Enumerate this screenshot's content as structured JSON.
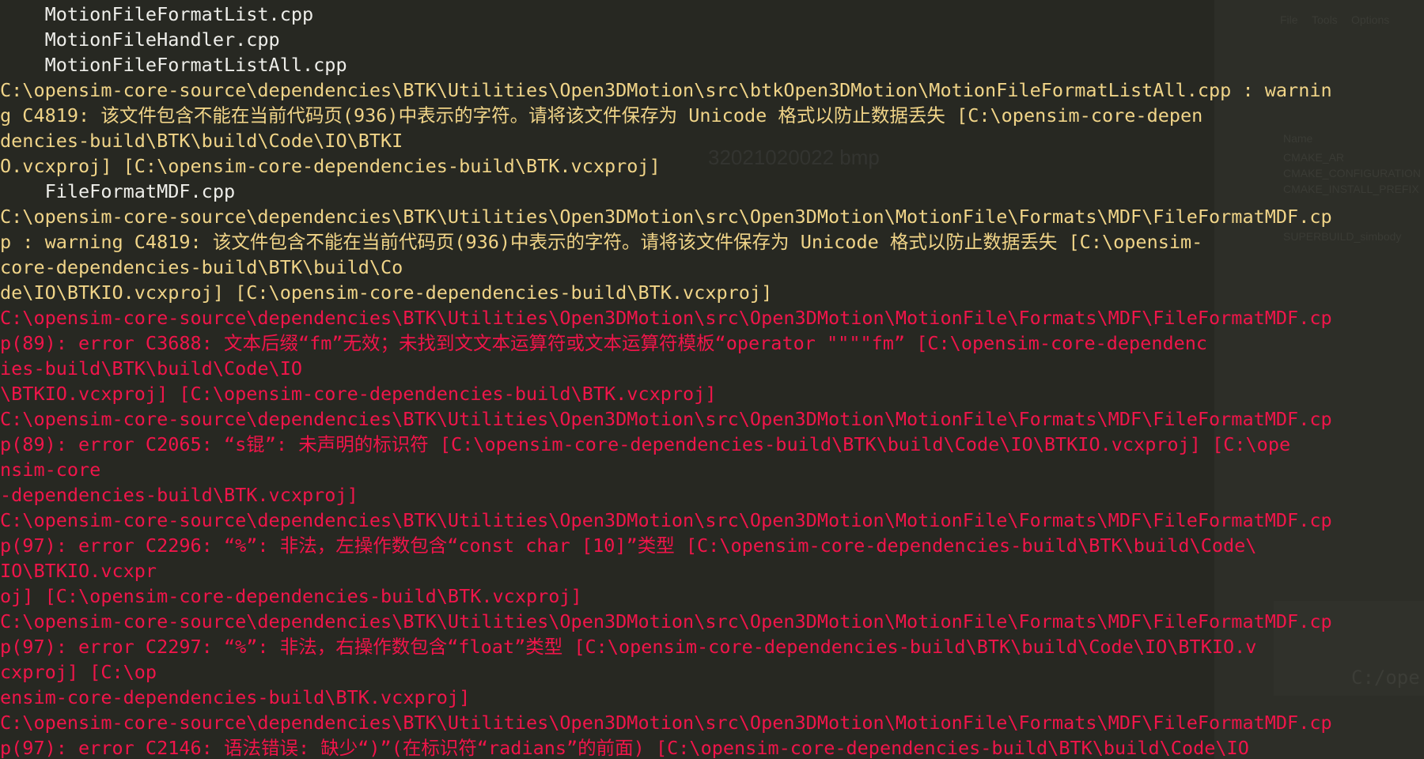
{
  "background_window": {
    "menu_items": [
      "File",
      "Tools",
      "Options"
    ],
    "labels": [
      "Name",
      "CMAKE_AR",
      "CMAKE_CONFIGURATION",
      "CMAKE_INSTALL_PREFIX",
      "SUPERBUILD_simbody"
    ],
    "path_fragment": "C:/ope",
    "file_fragment": "32021020022 bmp"
  },
  "colors": {
    "background": "#272822",
    "normal": "#eeeeea",
    "warning": "#f0d488",
    "error": "#f0154a"
  },
  "console": {
    "lines": [
      {
        "type": "normal",
        "text": "    MotionFileFormatList.cpp"
      },
      {
        "type": "normal",
        "text": "    MotionFileHandler.cpp"
      },
      {
        "type": "normal",
        "text": "    MotionFileFormatListAll.cpp"
      },
      {
        "type": "warning",
        "text": "C:\\opensim-core-source\\dependencies\\BTK\\Utilities\\Open3DMotion\\src\\btkOpen3DMotion\\MotionFileFormatListAll.cpp : warnin"
      },
      {
        "type": "warning",
        "text": "g C4819: 该文件包含不能在当前代码页(936)中表示的字符。请将该文件保存为 Unicode 格式以防止数据丢失 [C:\\opensim-core-depen"
      },
      {
        "type": "warning",
        "text": "dencies-build\\BTK\\build\\Code\\IO\\BTKI"
      },
      {
        "type": "warning",
        "text": "O.vcxproj] [C:\\opensim-core-dependencies-build\\BTK.vcxproj]"
      },
      {
        "type": "normal",
        "text": "    FileFormatMDF.cpp"
      },
      {
        "type": "warning",
        "text": "C:\\opensim-core-source\\dependencies\\BTK\\Utilities\\Open3DMotion\\src\\Open3DMotion\\MotionFile\\Formats\\MDF\\FileFormatMDF.cp"
      },
      {
        "type": "warning",
        "text": "p : warning C4819: 该文件包含不能在当前代码页(936)中表示的字符。请将该文件保存为 Unicode 格式以防止数据丢失 [C:\\opensim-"
      },
      {
        "type": "warning",
        "text": "core-dependencies-build\\BTK\\build\\Co"
      },
      {
        "type": "warning",
        "text": "de\\IO\\BTKIO.vcxproj] [C:\\opensim-core-dependencies-build\\BTK.vcxproj]"
      },
      {
        "type": "error",
        "text": "C:\\opensim-core-source\\dependencies\\BTK\\Utilities\\Open3DMotion\\src\\Open3DMotion\\MotionFile\\Formats\\MDF\\FileFormatMDF.cp"
      },
      {
        "type": "error",
        "text": "p(89): error C3688: 文本后缀“fm”无效；未找到文文本运算符或文本运算符模板“operator \"\"\"\"fm” [C:\\opensim-core-dependenc"
      },
      {
        "type": "error",
        "text": "ies-build\\BTK\\build\\Code\\IO"
      },
      {
        "type": "error",
        "text": "\\BTKIO.vcxproj] [C:\\opensim-core-dependencies-build\\BTK.vcxproj]"
      },
      {
        "type": "error",
        "text": "C:\\opensim-core-source\\dependencies\\BTK\\Utilities\\Open3DMotion\\src\\Open3DMotion\\MotionFile\\Formats\\MDF\\FileFormatMDF.cp"
      },
      {
        "type": "error",
        "text": "p(89): error C2065: “s锟”: 未声明的标识符 [C:\\opensim-core-dependencies-build\\BTK\\build\\Code\\IO\\BTKIO.vcxproj] [C:\\ope"
      },
      {
        "type": "error",
        "text": "nsim-core"
      },
      {
        "type": "error",
        "text": "-dependencies-build\\BTK.vcxproj]"
      },
      {
        "type": "error",
        "text": "C:\\opensim-core-source\\dependencies\\BTK\\Utilities\\Open3DMotion\\src\\Open3DMotion\\MotionFile\\Formats\\MDF\\FileFormatMDF.cp"
      },
      {
        "type": "error",
        "text": "p(97): error C2296: “%”: 非法，左操作数包含“const char [10]”类型 [C:\\opensim-core-dependencies-build\\BTK\\build\\Code\\"
      },
      {
        "type": "error",
        "text": "IO\\BTKIO.vcxpr"
      },
      {
        "type": "error",
        "text": "oj] [C:\\opensim-core-dependencies-build\\BTK.vcxproj]"
      },
      {
        "type": "error",
        "text": "C:\\opensim-core-source\\dependencies\\BTK\\Utilities\\Open3DMotion\\src\\Open3DMotion\\MotionFile\\Formats\\MDF\\FileFormatMDF.cp"
      },
      {
        "type": "error",
        "text": "p(97): error C2297: “%”: 非法，右操作数包含“float”类型 [C:\\opensim-core-dependencies-build\\BTK\\build\\Code\\IO\\BTKIO.v"
      },
      {
        "type": "error",
        "text": "cxproj] [C:\\op"
      },
      {
        "type": "error",
        "text": "ensim-core-dependencies-build\\BTK.vcxproj]"
      },
      {
        "type": "error",
        "text": "C:\\opensim-core-source\\dependencies\\BTK\\Utilities\\Open3DMotion\\src\\Open3DMotion\\MotionFile\\Formats\\MDF\\FileFormatMDF.cp"
      },
      {
        "type": "error",
        "text": "p(97): error C2146: 语法错误: 缺少“)”(在标识符“radians”的前面) [C:\\opensim-core-dependencies-build\\BTK\\build\\Code\\IO"
      }
    ]
  }
}
